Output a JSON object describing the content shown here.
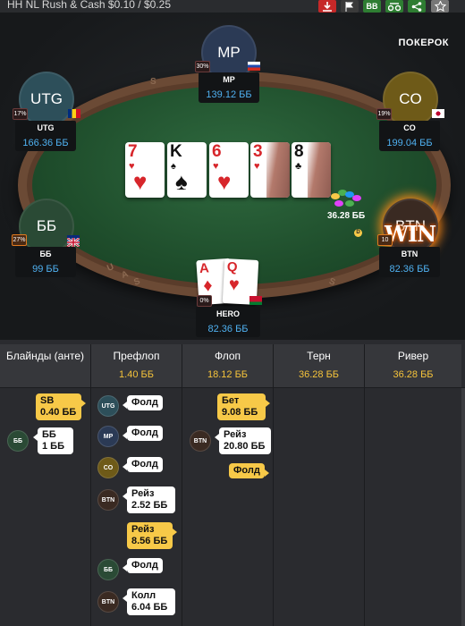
{
  "title": "HH NL Rush & Cash $0.10 / $0.25",
  "toolbar": {
    "colors": {
      "download": "#c62828",
      "flag": "#3a3a3a",
      "bb": "#2e7d32",
      "replay": "#2e7d32",
      "share": "#2e7d32",
      "star": "#777777"
    },
    "icons": [
      "download-icon",
      "flag-icon",
      "bb-toggle",
      "replay-icon",
      "share-icon",
      "star-icon"
    ],
    "bb_label": "BB"
  },
  "brand": "ПОКЕРОК",
  "players": {
    "mp": {
      "avatar": "MP",
      "name": "MP",
      "stack": "139.12 ББ",
      "pct": "30%",
      "color": "#2b3a55"
    },
    "utg": {
      "avatar": "UTG",
      "name": "UTG",
      "stack": "166.36 ББ",
      "pct": "17%",
      "color": "#2d4f5a"
    },
    "co": {
      "avatar": "CO",
      "name": "CO",
      "stack": "199.04 ББ",
      "pct": "19%",
      "color": "#6e5a18"
    },
    "bb": {
      "avatar": "ББ",
      "name": "ББ",
      "stack": "99 ББ",
      "pct": "27%",
      "color": "#2a4a35"
    },
    "btn": {
      "avatar": "BTN",
      "name": "BTN",
      "stack": "82.36 ББ",
      "pct": "10",
      "color": "#3a2a22",
      "win": "WIN"
    },
    "hero": {
      "name": "HERO",
      "stack": "82.36 ББ",
      "pct": "0%"
    }
  },
  "board": [
    {
      "rank": "7",
      "suit": "♥",
      "color": "red"
    },
    {
      "rank": "K",
      "suit": "♠",
      "color": "blk"
    },
    {
      "rank": "6",
      "suit": "♥",
      "color": "red"
    },
    {
      "rank": "3",
      "suit": "♥",
      "color": "red"
    },
    {
      "rank": "8",
      "suit": "♣",
      "color": "blk"
    }
  ],
  "hero_cards": [
    {
      "rank": "A",
      "suit": "♦"
    },
    {
      "rank": "Q",
      "suit": "♥"
    }
  ],
  "pot": "36.28 ББ",
  "rim_letters": [
    "S",
    "A",
    "S",
    "U",
    "S"
  ],
  "history": {
    "columns": [
      {
        "title": "Блайнды (анте)",
        "amount": ""
      },
      {
        "title": "Префлоп",
        "amount": "1.40 ББ"
      },
      {
        "title": "Флоп",
        "amount": "18.12 ББ"
      },
      {
        "title": "Терн",
        "amount": "36.28 ББ"
      },
      {
        "title": "Ривер",
        "amount": "36.28 ББ"
      }
    ],
    "blinds": {
      "sb": [
        "SB",
        "0.40 ББ"
      ],
      "bb_avatar": "ББ",
      "bb": [
        "ББ",
        "1 ББ"
      ]
    },
    "preflop": [
      {
        "avatar": "UTG",
        "action": "Фолд"
      },
      {
        "avatar": "MP",
        "action": "Фолд"
      },
      {
        "avatar": "CO",
        "action": "Фолд"
      },
      {
        "avatar": "BTN",
        "action": "Рейз",
        "amount": "2.52 ББ"
      },
      {
        "action": "Рейз",
        "amount": "8.56 ББ"
      },
      {
        "avatar": "ББ",
        "action": "Фолд"
      },
      {
        "avatar": "BTN",
        "action": "Колл",
        "amount": "6.04 ББ"
      }
    ],
    "flop": [
      {
        "action": "Бет",
        "amount": "9.08 ББ"
      },
      {
        "avatar": "BTN",
        "action": "Рейз",
        "amount": "20.80 ББ"
      },
      {
        "action": "Фолд"
      }
    ]
  }
}
